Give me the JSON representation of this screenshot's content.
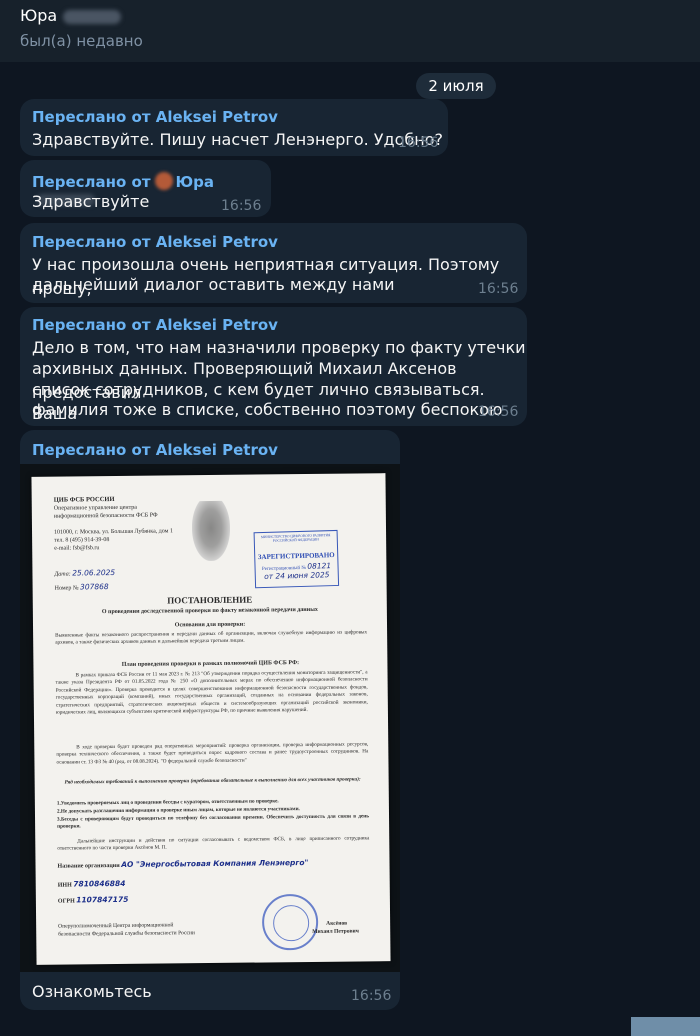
{
  "header": {
    "name": "Юра",
    "status": "был(а) недавно"
  },
  "date_separator": "2 июля",
  "messages": [
    {
      "forwarded_label": "Переслано от Aleksei Petrov",
      "lines": [
        "Здравствуйте. Пишу насчет Ленэнерго. Удобно?"
      ],
      "time": "16:56"
    },
    {
      "forwarded_prefix": "Переслано от",
      "forwarded_name": "Юра",
      "lines": [
        "Здравствуйте"
      ],
      "time": "16:56"
    },
    {
      "forwarded_label": "Переслано от Aleksei Petrov",
      "lines": [
        "У нас произошла очень неприятная ситуация. Поэтому прошу,",
        "дальнейший диалог оставить между нами"
      ],
      "time": "16:56"
    },
    {
      "forwarded_label": "Переслано от Aleksei Petrov",
      "lines": [
        "Дело в том, что нам назначили проверку по факту утечки",
        "архивных данных. Проверяющий Михаил Аксенов предоставил",
        "список сотрудников, с кем будет лично связываться. Ваша",
        "фамилия тоже в списке, собственно поэтому беспокою"
      ],
      "time": "16:56"
    },
    {
      "forwarded_label": "Переслано от Aleksei Petrov",
      "caption": "Ознакомьтесь",
      "time": "16:56"
    }
  ],
  "document": {
    "org_title": "ЦИБ ФСБ РОССИИ",
    "org_lines": [
      "Оперативное управление центра",
      "информационной безопасности ФСБ РФ",
      "",
      "101000, г. Москва, ул. Большая Лубянка, дом 1",
      "тел. 8 (495) 914-39-08",
      "e-mail: fsb@fsb.ru"
    ],
    "stamp_top": "МИНИСТЕРСТВО ЦИФРОВОГО РАЗВИТИЯ РОССИЙСКОЙ ФЕДЕРАЦИИ",
    "stamp_main": "ЗАРЕГИСТРИРОВАНО",
    "stamp_reg_label": "Регистрационный №",
    "stamp_reg_value": "08121",
    "stamp_date": "от 24 июня 2025",
    "date_label": "Дата:",
    "date_value": "25.06.2025",
    "number_label": "Номер №",
    "number_value": "307868",
    "title": "ПОСТАНОВЛЕНИЕ",
    "subtitle": "О проведении доследственной проверки по факту незаконной передачи данных",
    "basis_heading": "Основания для проверки:",
    "basis_text": "Выявленные факты незаконного распространения и передачи данных об организации, включая служебную информацию из цифровых архивов, а также физических архивов данных и дальнейшая передача третьим лицам.",
    "plan_heading": "План проведения проверки в рамках полномочий ЦИБ ФСБ РФ:",
    "plan_text_1": "В рамках приказа ФСБ России от 11 мая 2023 г. № 213 \"Об утверждении порядка осуществления мониторинга защищенности\", а также указа Президента РФ от 01.05.2022 года № 250 «О дополнительных мерах по обеспечению информационной безопасности Российской Федерации». Проверка проводится в целях совершенствования информационной безопасности государственных фондов, государственных корпораций (компаний), иных государственных организаций, созданных на основании федеральных законов, стратегических предприятий, стратегических акционерных обществ и системообразующих организаций российской экономики, юридических лиц, являющихся субъектами критической инфраструктуры РФ, по причине выявления нарушений.",
    "plan_text_2": "В ходе проверки будет проведен ряд оперативных мероприятий: проверка организации, проверка информационных ресурсов, проверка технического обеспечения, а также будет проводиться опрос кадрового состава и ранее трудоустроенных сотрудников. На основании ст. 13 ФЗ № 40 (ред. от 08.08.2024). \"О федеральной службе безопасности\"",
    "req_heading": "Ряд необходимых требований к выполнению проверки (требования обязательные к выполнению для всех участников проверки):",
    "req_items": [
      "1.Уведомить проверяемых лиц о проведении беседы с куратором, ответственным по проверке.",
      "2.Не допускать разглашения информации о проверке иным лицам, которые не являются участниками.",
      "3.Беседы с проверяющим будут проводиться по телефону без согласования времени. Обеспечить доступность для связи в день проверки."
    ],
    "further_text": "Дальнейшие инструкции и действия по ситуации согласовывать с ведомством ФСБ, в лице приписанного сотрудника ответственного по части проверки Аксёнов М. П.",
    "field_org_label": "Название организации",
    "field_org_value": "АО \"Энергосбытовая Компания Ленэнерго\"",
    "field_inn_label": "ИНН",
    "field_inn_value": "7810846884",
    "field_ogrn_label": "ОГРН",
    "field_ogrn_value": "1107847175",
    "footer_lines": [
      "Оперуполномоченный Центра информационной",
      "безопасности Федеральной службы безопасности России"
    ],
    "signer_lines": [
      "Аксёнов",
      "Михаил Петрович"
    ]
  }
}
